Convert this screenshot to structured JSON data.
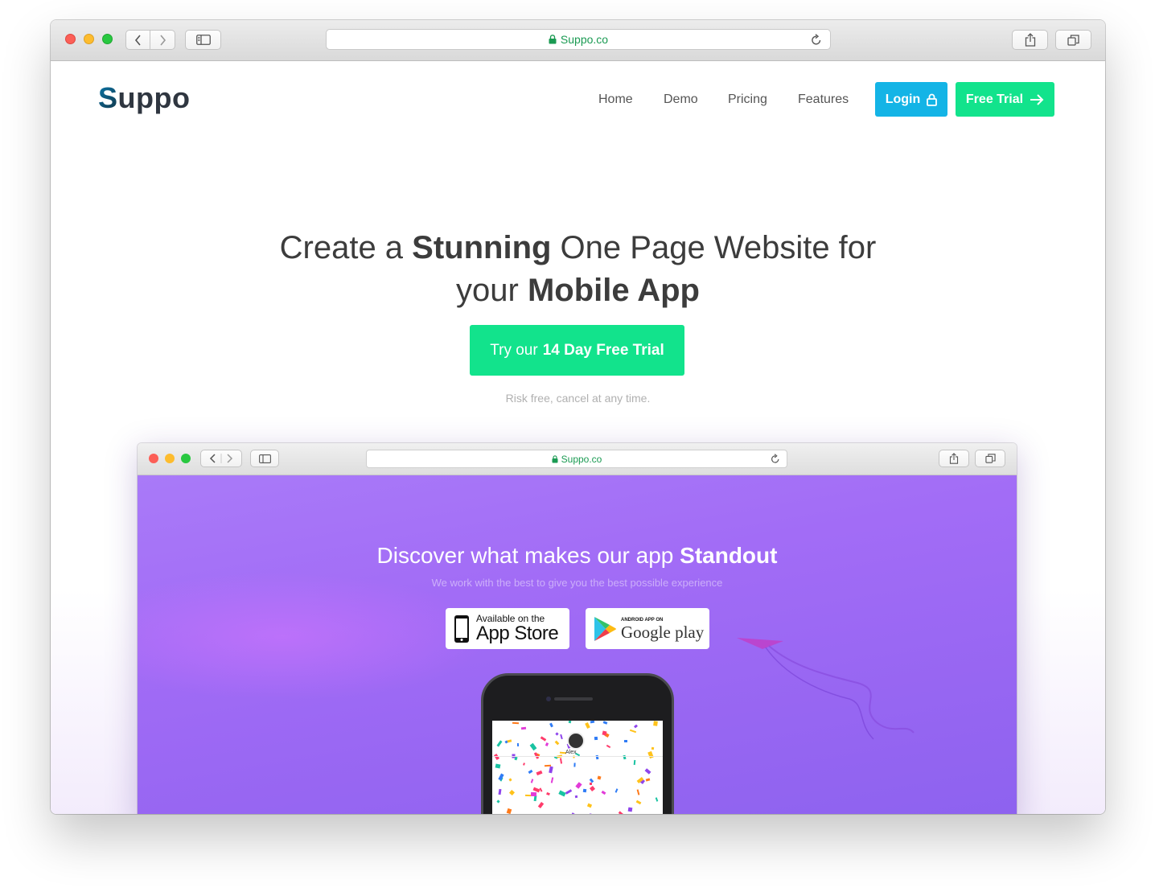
{
  "browser": {
    "url": "Suppo.co"
  },
  "site": {
    "logo_first": "S",
    "logo_rest": "uppo",
    "nav": [
      "Home",
      "Demo",
      "Pricing",
      "Features"
    ],
    "login_label": "Login",
    "free_trial_label": "Free Trial",
    "hero": {
      "line1_pre": "Create a ",
      "line1_bold": "Stunning",
      "line1_post": " One Page Website for",
      "line2_pre": "your ",
      "line2_bold": "Mobile App"
    },
    "cta": {
      "pre": "Try our",
      "bold": "14 Day Free Trial"
    },
    "risk_text": "Risk free, cancel at any time."
  },
  "preview": {
    "url": "Suppo.co",
    "title_pre": "Discover what makes our app ",
    "title_bold": "Standout",
    "subtitle": "We work with the best to give you the best possible experience",
    "appstore_small": "Available on the",
    "appstore_big": "App Store",
    "google_small": "ANDROID APP ON",
    "google_big": "Google play",
    "phone_user": "Alex"
  },
  "colors": {
    "login": "#14b4e6",
    "trial": "#12e38c",
    "preview_bg": "#a26cf6",
    "url_green": "#1a9a52"
  },
  "icons": [
    "lock-icon",
    "reload-icon",
    "sidebar-icon",
    "share-icon",
    "tabs-icon",
    "back-icon",
    "forward-icon",
    "arrow-right-icon",
    "padlock-icon",
    "apple-icon",
    "play-icon"
  ]
}
